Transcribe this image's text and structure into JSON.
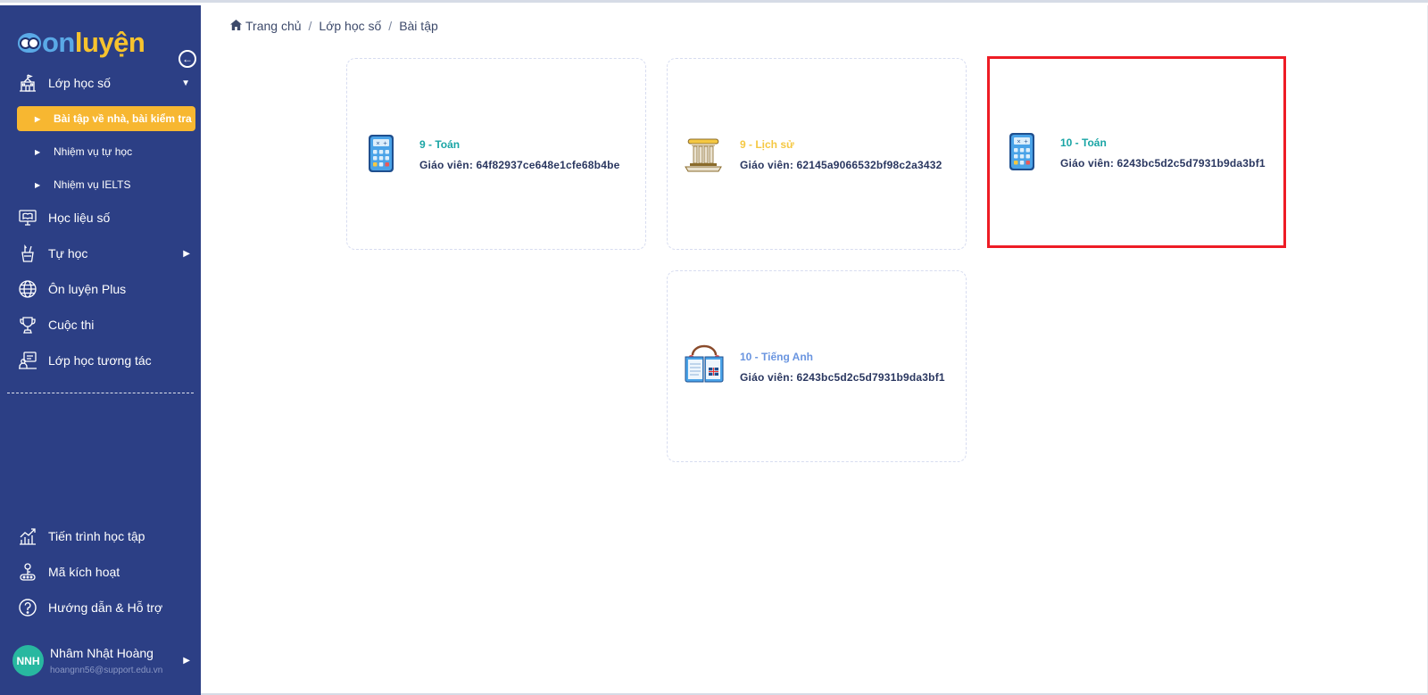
{
  "brand": {
    "on": "on",
    "luyen": "luyện"
  },
  "sidebar": {
    "collapse_icon": "arrow-left-circle-icon",
    "items": [
      {
        "label": "Lớp học số",
        "icon": "school-building-icon",
        "expanded": true
      },
      {
        "label": "Học liệu số",
        "icon": "monitor-book-icon"
      },
      {
        "label": "Tự học",
        "icon": "pencil-cup-icon"
      },
      {
        "label": "Ôn luyện Plus",
        "icon": "globe-icon"
      },
      {
        "label": "Cuộc thi",
        "icon": "trophy-icon"
      },
      {
        "label": "Lớp học tương tác",
        "icon": "interactive-class-icon"
      }
    ],
    "subitems": [
      {
        "label": "Bài tập về nhà, bài kiểm tra",
        "active": true
      },
      {
        "label": "Nhiệm vụ tự học"
      },
      {
        "label": "Nhiệm vụ IELTS"
      }
    ],
    "bottom_items": [
      {
        "label": "Tiến trình học tập",
        "icon": "chart-growth-icon"
      },
      {
        "label": "Mã kích hoạt",
        "icon": "activation-key-icon"
      },
      {
        "label": "Hướng dẫn & Hỗ trợ",
        "icon": "help-circle-icon"
      }
    ],
    "user": {
      "initials": "NNH",
      "name": "Nhâm Nhật Hoàng",
      "email": "hoangnn56@support.edu.vn"
    }
  },
  "breadcrumb": {
    "home": "Trang chủ",
    "level2": "Lớp học số",
    "current": "Bài tập"
  },
  "cards": [
    {
      "title": "9 - Toán",
      "teacher": "Giáo viên: 64f82937ce648e1cfe68b4be",
      "icon": "calculator-icon",
      "title_color": "#1aa5a5"
    },
    {
      "title": "9 - Lịch sử",
      "teacher": "Giáo viên: 62145a9066532bf98c2a3432",
      "icon": "history-column-icon",
      "title_color": "#f5c842"
    },
    {
      "title": "10 - Toán",
      "teacher": "Giáo viên: 6243bc5d2c5d7931b9da3bf1",
      "icon": "calculator-icon",
      "title_color": "#1aa5a5",
      "highlighted": true
    },
    {
      "title": "10 - Tiếng Anh",
      "teacher": "Giáo viên: 6243bc5d2c5d7931b9da3bf1",
      "icon": "english-book-icon",
      "title_color": "#6a95e0"
    }
  ],
  "colors": {
    "sidebar": "#2c3f85",
    "active": "#f7b731",
    "highlight": "#ee1c25"
  }
}
